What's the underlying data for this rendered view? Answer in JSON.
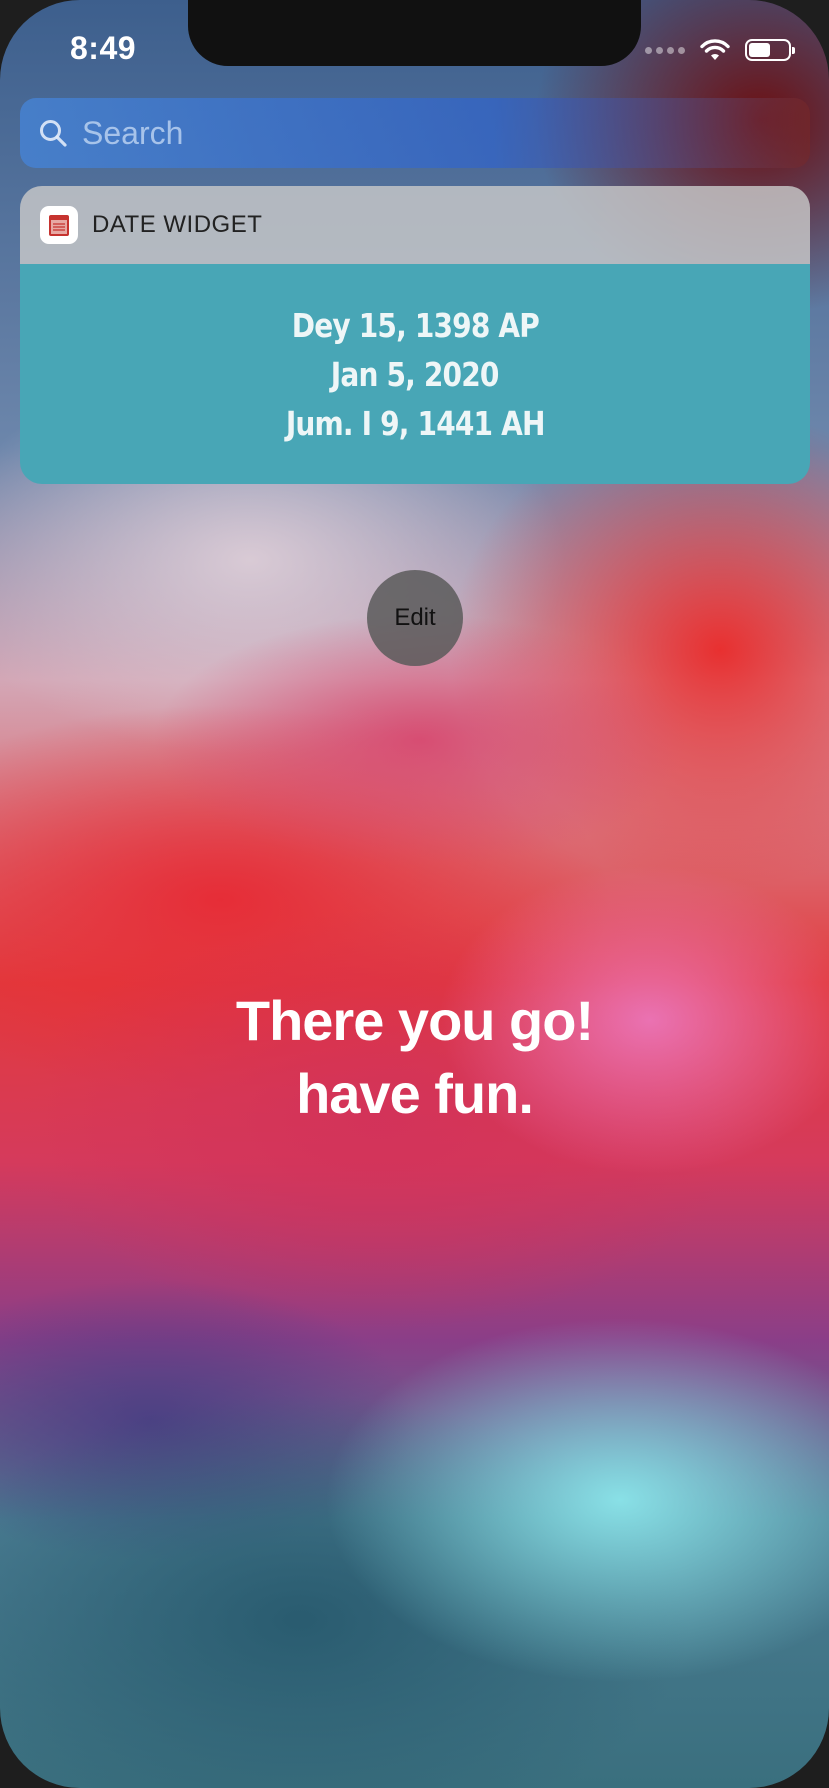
{
  "status_bar": {
    "time": "8:49",
    "battery_level": 0.55
  },
  "search": {
    "placeholder": "Search",
    "icon": "search-icon"
  },
  "widget": {
    "title": "DATE WIDGET",
    "app_icon": "calendar-icon",
    "dates": [
      "Dey 15, 1398 AP",
      "Jan 5, 2020",
      "Jum. I 9, 1441 AH"
    ]
  },
  "edit_button_label": "Edit",
  "message": {
    "line1": "There you go!",
    "line2": "have fun."
  }
}
